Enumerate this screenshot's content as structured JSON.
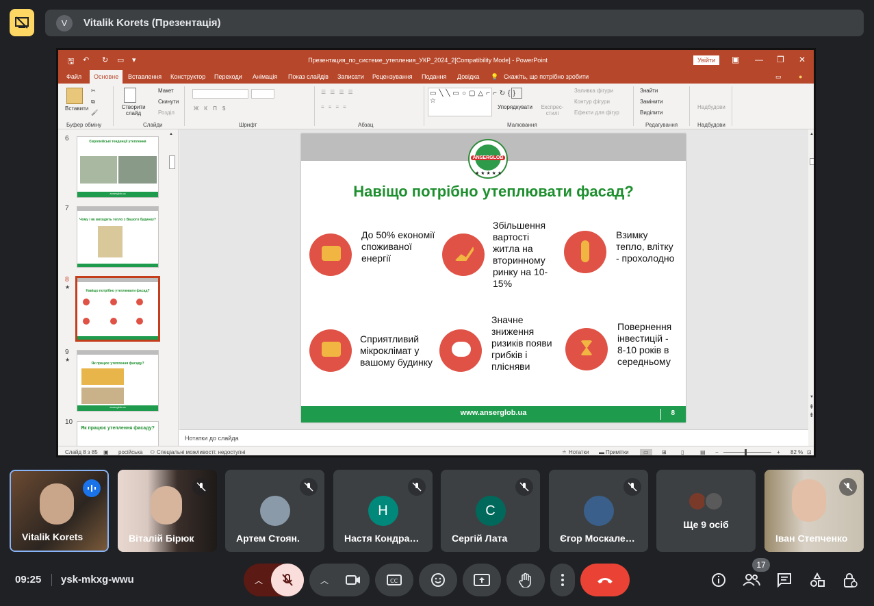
{
  "meeting": {
    "presenter_initial": "V",
    "banner_title": "Vitalik Korets (Презентація)",
    "time": "09:25",
    "code": "ysk-mkxg-wwu",
    "people_count": "17"
  },
  "powerpoint": {
    "window_title": "Презентация_по_системе_утепления_УКР_2024_2[Compatibility Mode]  -  PowerPoint",
    "signin": "Увійти",
    "tabs": [
      "Файл",
      "Основне",
      "Вставлення",
      "Конструктор",
      "Переходи",
      "Анімація",
      "Показ слайдів",
      "Записати",
      "Рецензування",
      "Подання",
      "Довідка"
    ],
    "tell_me": "Скажіть, що потрібно зробити",
    "ribbon": {
      "paste": "Вставити",
      "clipboard": "Буфер обміну",
      "new_slide": "Створити слайд",
      "layout": "Макет",
      "reset": "Скинути",
      "section": "Розділ",
      "slides": "Слайди",
      "font": "Шрифт",
      "paragraph": "Абзац",
      "arrange": "Упорядкувати",
      "quick_styles": "Експрес-стилі",
      "shape_fill": "Заливка фігури",
      "shape_outline": "Контур фігури",
      "shape_effects": "Ефекти для фігур",
      "drawing": "Малювання",
      "find": "Знайти",
      "replace": "Замінити",
      "select": "Виділити",
      "editing": "Редагування",
      "addins": "Надбудови",
      "addins_group": "Надбудови"
    },
    "thumbnails": [
      {
        "num": "6",
        "title": "Європейські тенденції утеплення",
        "footer": "anserglob.ua"
      },
      {
        "num": "7",
        "title": "Чому і як виходить тепло з Вашого будинку?",
        "footer": ""
      },
      {
        "num": "8",
        "title": "Навіщо потрібно утеплювати фасад?",
        "footer": ""
      },
      {
        "num": "9",
        "title": "Як працює утеплення фасаду?",
        "footer": "anserglob.ua"
      },
      {
        "num": "10",
        "title": "Як працює утеплення фасаду?",
        "footer": ""
      }
    ],
    "slide": {
      "logo_text": "ANSERGLOB",
      "logo_stars": "★ ★ ★ ★ ★",
      "title": "Навіщо потрібно утеплювати фасад?",
      "features": [
        {
          "text": "До 50% економії споживаної енергії",
          "icon": "wallet-icon"
        },
        {
          "text": "Збільшення вартості житла на вторинному ринку на 10-15%",
          "icon": "growth-chart-icon"
        },
        {
          "text": "Взимку тепло, влітку - прохолодно",
          "icon": "thermometer-icon"
        },
        {
          "text": "Сприятливий мікроклімат у вашому будинку",
          "icon": "thumbs-up-icon"
        },
        {
          "text": "Значне зниження ризиків появи грибків і плісняви",
          "icon": "sun-cloud-icon"
        },
        {
          "text": "Повернення інвестицій - 8-10 років в середньому",
          "icon": "hourglass-icon"
        }
      ],
      "footer_url": "www.anserglob.ua",
      "page_number": "8"
    },
    "notes_placeholder": "Нотатки до слайда",
    "status": {
      "slide_of": "Слайд 8 з 85",
      "language": "російська",
      "accessibility": "Спеціальні можливості: недоступні",
      "notes": "Нотатки",
      "comments": "Примітки",
      "zoom": "82 %"
    }
  },
  "participants": [
    {
      "name": "Vitalik Korets",
      "initial": "",
      "color": ""
    },
    {
      "name": "Віталій Бірюк",
      "initial": "",
      "color": ""
    },
    {
      "name": "Артем Стоян.",
      "initial": "",
      "color": "#8a9aa8"
    },
    {
      "name": "Настя Кондра…",
      "initial": "Н",
      "color": "#00897b"
    },
    {
      "name": "Сергій Лата",
      "initial": "С",
      "color": "#00695c"
    },
    {
      "name": "Єгор Москале…",
      "initial": "",
      "color": "#3a5f8a"
    },
    {
      "name": "Ще 9 осіб",
      "initial": "",
      "color": ""
    },
    {
      "name": "Іван Степченко",
      "initial": "",
      "color": ""
    }
  ],
  "colors": {
    "ppt_accent": "#b7472a",
    "slide_green": "#1e9b4c",
    "icon_red": "#e05246",
    "end_call": "#ea4335",
    "mic_off": "#f9dedc"
  }
}
